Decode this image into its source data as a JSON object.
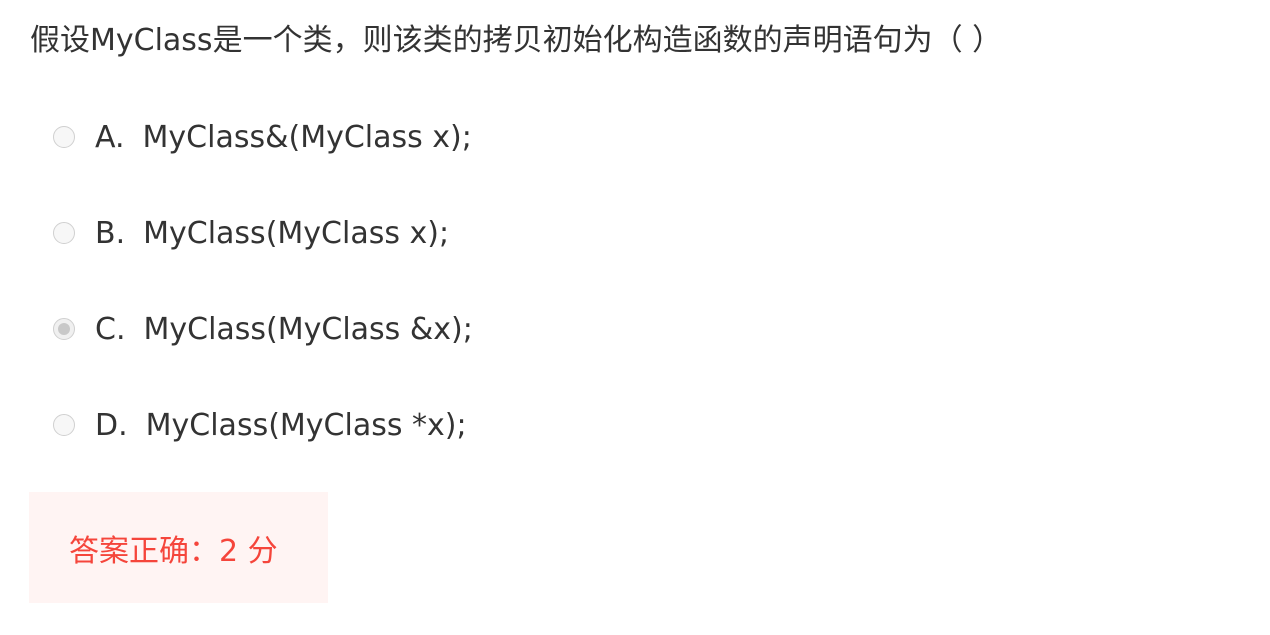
{
  "question": {
    "text": "假设MyClass是一个类，则该类的拷贝初始化构造函数的声明语句为（ ）"
  },
  "options": [
    {
      "letter": "A.",
      "text": "MyClass&(MyClass x);",
      "selected": false
    },
    {
      "letter": "B.",
      "text": "MyClass(MyClass x);",
      "selected": false
    },
    {
      "letter": "C.",
      "text": "MyClass(MyClass &x);",
      "selected": true
    },
    {
      "letter": "D.",
      "text": "MyClass(MyClass *x);",
      "selected": false
    }
  ],
  "result": {
    "text": "答案正确：2 分"
  },
  "colors": {
    "text": "#333333",
    "result_text": "#f5453b",
    "result_bg": "#fff4f3"
  }
}
